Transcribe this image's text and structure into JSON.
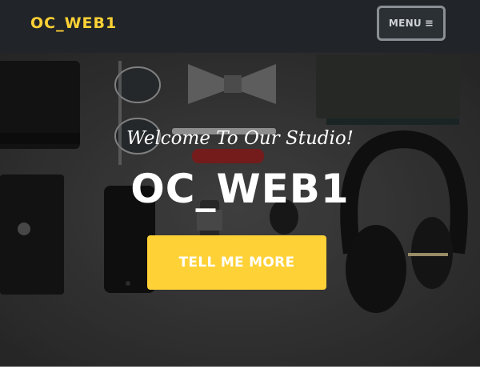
{
  "navbar": {
    "brand": "OC_WEB1",
    "menu_label": "MENU",
    "menu_icon": "≡"
  },
  "hero": {
    "lead": "Welcome To Our Studio!",
    "heading": "OC_WEB1",
    "cta_label": "TELL ME MORE"
  },
  "colors": {
    "accent": "#fed136",
    "navbar_bg": "#212529",
    "hero_text": "#ffffff"
  }
}
